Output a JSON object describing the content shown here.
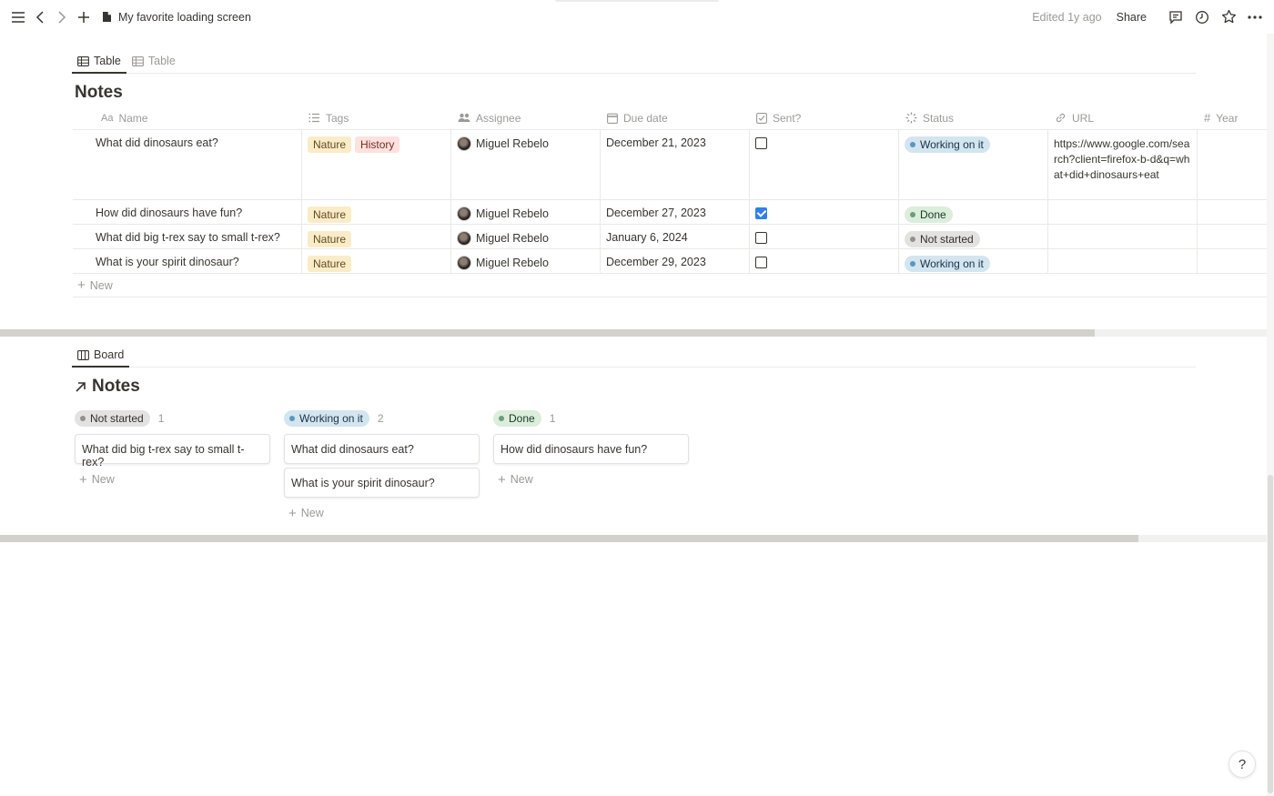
{
  "topbar": {
    "page_title": "My favorite loading screen",
    "edited": "Edited 1y ago",
    "share": "Share"
  },
  "table_view": {
    "tabs": [
      {
        "label": "Table",
        "active": true
      },
      {
        "label": "Table",
        "active": false
      }
    ],
    "title": "Notes",
    "columns": [
      "Name",
      "Tags",
      "Assignee",
      "Due date",
      "Sent?",
      "Status",
      "URL",
      "Year"
    ],
    "rows": [
      {
        "name": "What did dinosaurs eat?",
        "tags": [
          "Nature",
          "History"
        ],
        "assignee": "Miguel Rebelo",
        "due": "December 21, 2023",
        "sent": false,
        "status": "Working on it",
        "url": "https://www.google.com/search?client=firefox-b-d&q=what+did+dinosaurs+eat"
      },
      {
        "name": "How did dinosaurs have fun?",
        "tags": [
          "Nature"
        ],
        "assignee": "Miguel Rebelo",
        "due": "December 27, 2023",
        "sent": true,
        "status": "Done",
        "url": ""
      },
      {
        "name": "What did big t-rex say to small t-rex?",
        "tags": [
          "Nature"
        ],
        "assignee": "Miguel Rebelo",
        "due": "January 6, 2024",
        "sent": false,
        "status": "Not started",
        "url": ""
      },
      {
        "name": "What is your spirit dinosaur?",
        "tags": [
          "Nature"
        ],
        "assignee": "Miguel Rebelo",
        "due": "December 29, 2023",
        "sent": false,
        "status": "Working on it",
        "url": ""
      }
    ],
    "new_label": "New"
  },
  "board_view": {
    "tab": "Board",
    "title": "Notes",
    "columns": [
      {
        "status": "Not started",
        "count": "1",
        "cards": [
          "What did big t-rex say to small t-rex?"
        ]
      },
      {
        "status": "Working on it",
        "count": "2",
        "cards": [
          "What did dinosaurs eat?",
          "What is your spirit dinosaur?"
        ]
      },
      {
        "status": "Done",
        "count": "1",
        "cards": [
          "How did dinosaurs have fun?"
        ]
      }
    ],
    "new_label": "New"
  },
  "help": "?",
  "colors": {
    "text": "#37352f",
    "muted": "#9b9a97",
    "checkbox_checked": "#2f80ed",
    "tag_nature": "#fbecc8",
    "tag_history": "#fde2dd",
    "status_working": "#d3e5ef",
    "status_done": "#dbeddb",
    "status_not_started": "#e3e2e0"
  }
}
